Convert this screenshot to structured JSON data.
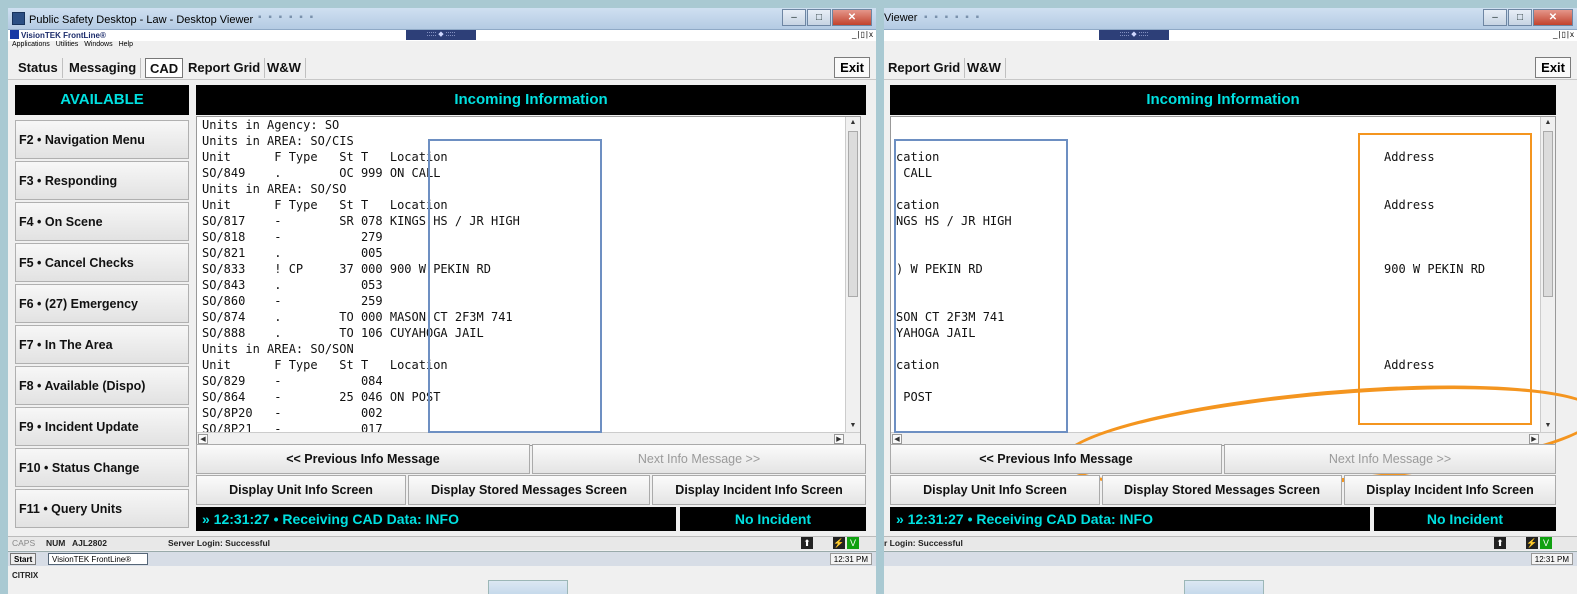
{
  "left": {
    "window_title": "Public Safety Desktop - Law - Desktop Viewer",
    "app_name": "VisionTEK FrontLine®",
    "menu": [
      "Applications",
      "Utilities",
      "Windows",
      "Help"
    ],
    "tabs": [
      "Status",
      "Messaging",
      "CAD",
      "Report Grid",
      "W&W"
    ],
    "exit_label": "Exit",
    "status": "AVAILABLE",
    "fkeys": [
      "F2 • Navigation Menu",
      "F3 • Responding",
      "F4 • On Scene",
      "F5 • Cancel Checks",
      "F6 • (27) Emergency",
      "F7 • In The Area",
      "F8 • Available (Dispo)",
      "F9 • Incident Update",
      "F10 • Status Change",
      "F11 • Query Units"
    ],
    "info_header": "Incoming Information",
    "lines": [
      "Units in Agency: SO",
      "Units in AREA: SO/CIS",
      "Unit      F Type   St T   Location",
      "SO/849    .        OC 999 ON CALL",
      "Units in AREA: SO/SO",
      "Unit      F Type   St T   Location",
      "SO/817    -        SR 078 KINGS HS / JR HIGH",
      "SO/818    -           279",
      "SO/821    .           005",
      "SO/833    ! CP     37 000 900 W PEKIN RD",
      "SO/843    .           053",
      "SO/860    -           259",
      "SO/874    .        TO 000 MASON CT 2F3M 741",
      "SO/888    .        TO 106 CUYAHOGA JAIL",
      "Units in AREA: SO/SON",
      "Unit      F Type   St T   Location",
      "SO/829    -           084",
      "SO/864    -        25 046 ON POST",
      "SO/8P20   -           002",
      "SO/8P21   -           017"
    ],
    "prev_label": "<< Previous Info Message",
    "next_label": "Next Info Message >>",
    "display_unit": "Display Unit Info Screen",
    "display_stored": "Display Stored Messages Screen",
    "display_incident": "Display Incident Info Screen",
    "cad_status": "» 12:31:27 • Receiving CAD Data: INFO",
    "incident_status": "No Incident",
    "status_caps": "CAPS",
    "status_num": "NUM",
    "status_user": "AJL2802",
    "status_server": "Server Login: Successful",
    "start": "Start",
    "task": "VisionTEK FrontLine®",
    "clock": "12:31 PM",
    "citrix": "CITRIX"
  },
  "right": {
    "window_title": "Viewer",
    "tabs": [
      "Report Grid",
      "W&W"
    ],
    "exit_label": "Exit",
    "info_header": "Incoming Information",
    "loc_lines": [
      "",
      "",
      "cation",
      " CALL",
      "",
      "cation",
      "NGS HS / JR HIGH",
      "",
      "",
      ") W PEKIN RD",
      "",
      "",
      "SON CT 2F3M 741",
      "YAHOGA JAIL",
      "",
      "cation",
      "",
      " POST",
      "",
      ""
    ],
    "addr_lines": [
      "",
      "",
      "Address",
      "",
      "",
      "Address",
      "",
      "",
      "",
      "900 W PEKIN RD",
      "",
      "",
      "",
      "",
      "",
      "Address",
      "",
      "",
      "",
      ""
    ],
    "prev_label": "<< Previous Info Message",
    "next_label": "Next Info Message >>",
    "display_unit": "Display Unit Info Screen",
    "display_stored": "Display Stored Messages Screen",
    "display_incident": "Display Incident Info Screen",
    "cad_status": "» 12:31:27 • Receiving CAD Data: INFO",
    "incident_status": "No Incident",
    "status_server": "r Login: Successful",
    "clock": "12:31 PM"
  },
  "colors": {
    "highlight_blue": "#6d8fc2",
    "highlight_orange": "#f4951f",
    "status_cyan": "#00e0e0"
  }
}
